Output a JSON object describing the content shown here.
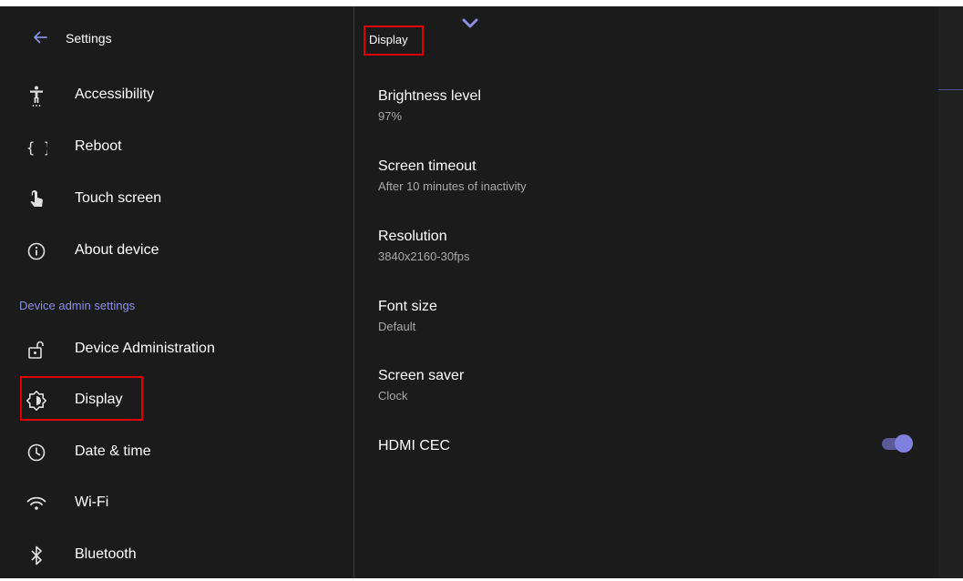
{
  "header": {
    "title": "Settings"
  },
  "nav": {
    "items_top": [
      {
        "label": "Accessibility",
        "icon": "accessibility-icon"
      },
      {
        "label": "Reboot",
        "icon": "braces-icon"
      },
      {
        "label": "Touch screen",
        "icon": "touch-icon"
      },
      {
        "label": "About device",
        "icon": "info-icon"
      }
    ],
    "section_label": "Device admin settings",
    "items_admin": [
      {
        "label": "Device Administration",
        "icon": "lock-open-icon"
      },
      {
        "label": "Display",
        "icon": "brightness-icon"
      },
      {
        "label": "Date & time",
        "icon": "clock-icon"
      },
      {
        "label": "Wi-Fi",
        "icon": "wifi-icon"
      },
      {
        "label": "Bluetooth",
        "icon": "bluetooth-icon"
      }
    ]
  },
  "display": {
    "title": "Display",
    "settings": [
      {
        "title": "Brightness level",
        "value": "97%"
      },
      {
        "title": "Screen timeout",
        "value": "After 10 minutes of inactivity"
      },
      {
        "title": "Resolution",
        "value": "3840x2160-30fps"
      },
      {
        "title": "Font size",
        "value": "Default"
      },
      {
        "title": "Screen saver",
        "value": "Clock"
      }
    ],
    "hdmi_cec": {
      "title": "HDMI CEC",
      "enabled": true
    }
  },
  "colors": {
    "background": "#1b1b1b",
    "accent": "#8080de",
    "highlight": "#e00000",
    "section_label": "#8a8ee0"
  }
}
